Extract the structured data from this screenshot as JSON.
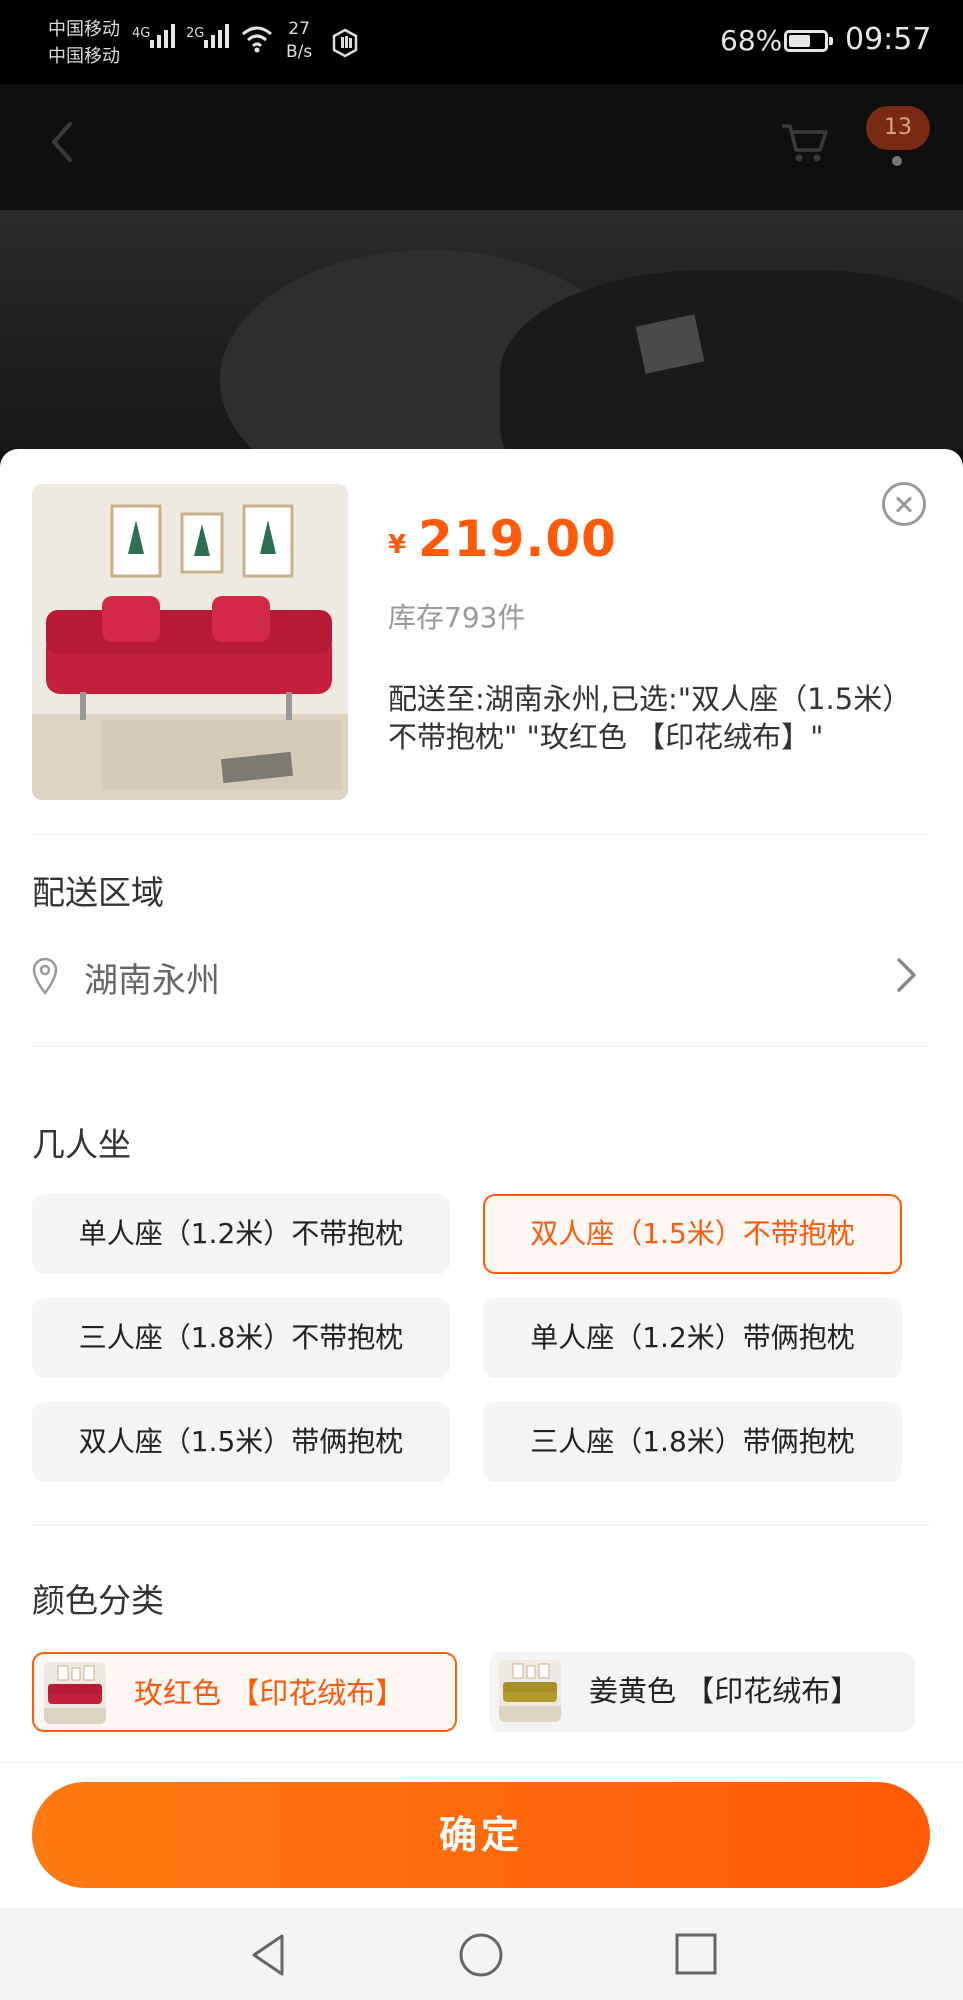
{
  "status_bar": {
    "carrier_1": "中国移动",
    "carrier_2": "中国移动",
    "net_1": "4G",
    "net_2": "2G",
    "speed_value": "27",
    "speed_unit": "B/s",
    "battery_pct": "68%",
    "battery_level": 0.68,
    "time": "09:57"
  },
  "header": {
    "cart_badge": "13",
    "icons": [
      "back-icon",
      "cart-icon"
    ]
  },
  "product": {
    "currency": "¥",
    "price": "219.00",
    "stock": "库存793件",
    "selected_info": "配送至:湖南永州,已选:\"双人座（1.5米）不带抱枕\" \"玫红色 【印花绒布】\""
  },
  "delivery": {
    "title": "配送区域",
    "region": "湖南永州"
  },
  "seats": {
    "title": "几人坐",
    "options": [
      {
        "label": "单人座（1.2米）不带抱枕",
        "selected": false
      },
      {
        "label": "双人座（1.5米）不带抱枕",
        "selected": true
      },
      {
        "label": "三人座（1.8米）不带抱枕",
        "selected": false
      },
      {
        "label": "单人座（1.2米）带俩抱枕",
        "selected": false
      },
      {
        "label": "双人座（1.5米）带俩抱枕",
        "selected": false
      },
      {
        "label": "三人座（1.8米）带俩抱枕",
        "selected": false
      }
    ]
  },
  "colors": {
    "title": "颜色分类",
    "options": [
      {
        "label": "玫红色 【印花绒布】",
        "selected": true,
        "swatch": "#c4203c"
      },
      {
        "label": "姜黄色 【印花绒布】",
        "selected": false,
        "swatch": "#b49a2e"
      }
    ]
  },
  "footer": {
    "confirm_label": "确定"
  },
  "theme": {
    "accent": "#ff5a0a"
  }
}
